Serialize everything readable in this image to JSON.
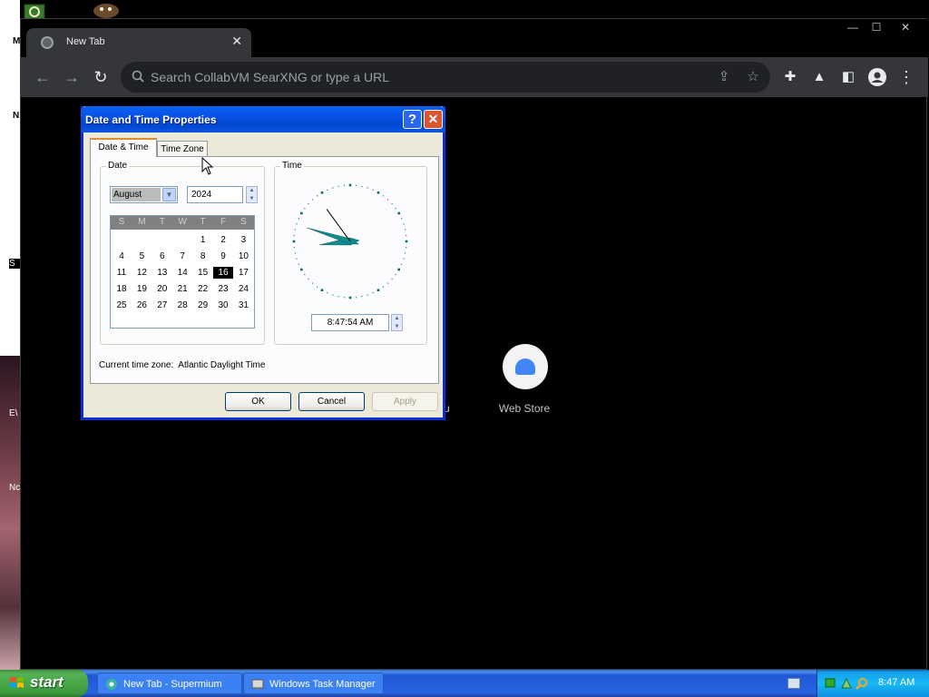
{
  "desktop": {
    "fragments": {
      "micro": "Micr",
      "st": "St",
      "ev": "E\\",
      "no": "Nc",
      "s": "S",
      "m1": "M",
      "m2": "N"
    }
  },
  "browser": {
    "tab": {
      "title": "New Tab",
      "close": "✕"
    },
    "window_controls": {
      "minimize": "—",
      "maximize": "☐",
      "close": "✕"
    },
    "omnibox": {
      "placeholder": "Search CollabVM SearXNG or type a URL"
    },
    "shortcuts": {
      "web_store_label": "Web Store",
      "partial_label": "u"
    }
  },
  "dialog": {
    "title": "Date and Time Properties",
    "help": "?",
    "close": "✕",
    "tabs": {
      "date_time": "Date & Time",
      "time_zone": "Time Zone"
    },
    "date_group_label": "Date",
    "time_group_label": "Time",
    "month": "August",
    "year": "2024",
    "weekday_headers": [
      "S",
      "M",
      "T",
      "W",
      "T",
      "F",
      "S"
    ],
    "calendar_rows": [
      [
        "",
        "",
        "",
        "",
        "1",
        "2",
        "3"
      ],
      [
        "4",
        "5",
        "6",
        "7",
        "8",
        "9",
        "10"
      ],
      [
        "11",
        "12",
        "13",
        "14",
        "15",
        "16",
        "17"
      ],
      [
        "18",
        "19",
        "20",
        "21",
        "22",
        "23",
        "24"
      ],
      [
        "25",
        "26",
        "27",
        "28",
        "29",
        "30",
        "31"
      ]
    ],
    "selected_day": "16",
    "time": "8:47:54 AM",
    "clock": {
      "hour": 8,
      "minute": 47,
      "second": 54
    },
    "current_time_zone_label": "Current time zone:",
    "current_time_zone": "Atlantic Daylight Time",
    "buttons": {
      "ok": "OK",
      "cancel": "Cancel",
      "apply": "Apply"
    }
  },
  "taskbar": {
    "start": "start",
    "tasks": [
      {
        "label": "New Tab - Supermium"
      },
      {
        "label": "Windows Task Manager"
      }
    ],
    "clock": "8:47 AM"
  },
  "colors": {
    "xp_title_blue": "#0a61f4",
    "dialog_face": "#ece9d8",
    "chrome_toolbar": "#35363a",
    "clock_hand_teal": "#138c8c"
  }
}
